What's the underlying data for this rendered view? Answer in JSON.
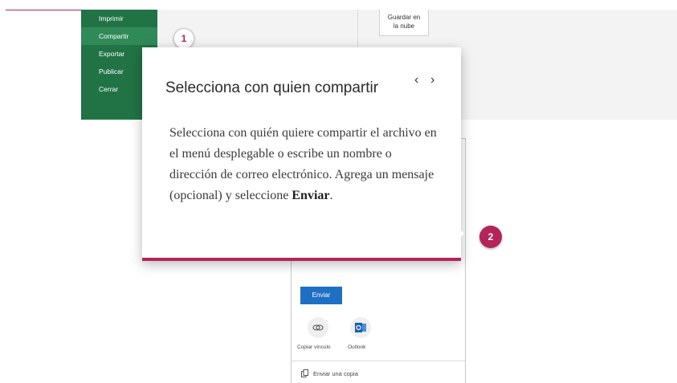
{
  "sidebar": {
    "items": [
      {
        "label": "Imprimir"
      },
      {
        "label": "Compartir"
      },
      {
        "label": "Exportar"
      },
      {
        "label": "Publicar"
      },
      {
        "label": "Cerrar"
      }
    ]
  },
  "toolbar": {
    "save_cloud_label_line1": "Guardar en",
    "save_cloud_label_line2": "la nube"
  },
  "markers": {
    "step1": "1",
    "step2": "2"
  },
  "popover": {
    "title": "Selecciona con quien compartir",
    "prev": "‹",
    "next": "›",
    "body": "Selecciona con quién quiere compartir el archivo en el menú desplegable o escribe un nombre o dirección de correo electrónico. Agrega un mensaje (opcional) y seleccione",
    "body_bold": "Enviar",
    "body_end": "."
  },
  "share_panel": {
    "send_label": "Enviar",
    "copy_link_label": "Copiar vínculo",
    "outlook_label": "Outlook",
    "send_copy_label": "Enviar una copia"
  },
  "colors": {
    "accent": "#b3245a",
    "sidebar": "#217346",
    "send": "#1f6fc5"
  }
}
